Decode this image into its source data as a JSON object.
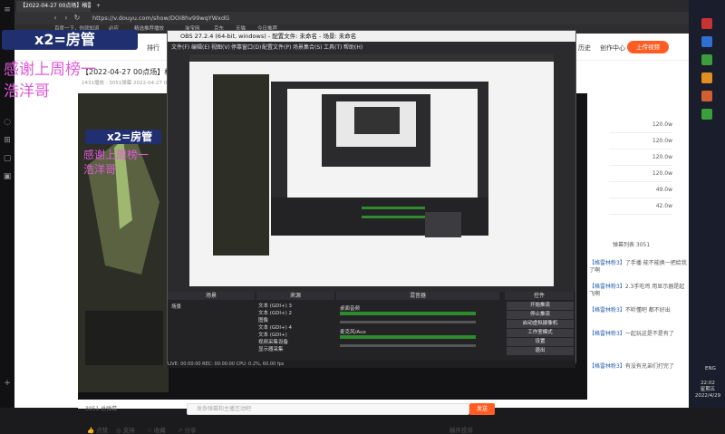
{
  "browser": {
    "tabs": [
      {
        "label": "【2022-04-27 00点场】格雷林"
      },
      {
        "label": ""
      },
      {
        "label": ""
      },
      {
        "label": ""
      }
    ],
    "url": "https://v.douyu.com/show/DOi8hv99wqYWxdG",
    "bookmarks": [
      "百度一下，你就知道",
      "必应",
      "精选推荐播放",
      "淘宝网",
      "京东",
      "天猫",
      "今日推荐"
    ]
  },
  "site": {
    "links": [
      "排行",
      "历史",
      "创作中心"
    ],
    "upload_label": "上传视频",
    "room_title": "【2022-04-27 00点场】格雷林",
    "room_meta": "1431播放 · 3051弹幕   2022-04-27 05:49",
    "rank_values": [
      "120.0w",
      "120.0w",
      "120.0w",
      "120.0w",
      "49.0w",
      "42.0w"
    ],
    "rank_head": "弹幕列表 3051",
    "chat": [
      {
        "name": "【格雷林粉3】",
        "text": "了手播 能不能换一把给我了啊"
      },
      {
        "name": "【格雷林粉3】",
        "text": "2.3手吃鸡 用显示器是起飞啊"
      },
      {
        "name": "【格雷林粉3】",
        "text": "不听懂吧 都不好出"
      },
      {
        "name": "【格雷林粉3】",
        "text": "一起玩这是不是有了"
      },
      {
        "name": "【格雷林粉3】",
        "text": "有没有兄弟们打完了"
      }
    ],
    "viewers": "3051 总弹幕",
    "danmu_placeholder": "发条弹幕和主播互动吧",
    "send_label": "发送",
    "actions": [
      "点赞",
      "支持",
      "收藏",
      "分享"
    ],
    "report_label": "稿件投诉"
  },
  "obs": {
    "title": "OBS 27.2.4 (64-bit, windows) - 配置文件: 未命名 - 场景: 未命名",
    "menu": [
      "文件(F)",
      "编辑(E)",
      "视图(V)",
      "停靠窗口(D)",
      "配置文件(P)",
      "场景集合(S)",
      "工具(T)",
      "帮助(H)"
    ],
    "docks": [
      "场景",
      "来源",
      "混音器",
      "转场特效",
      "控件"
    ],
    "no_source": "未选择源",
    "scene": "场景",
    "sources": [
      "文本 (GDI+) 3",
      "文本 (GDI+) 2",
      "图像",
      "文本 (GDI+) 4",
      "文本 (GDI+)",
      "视频采集设备",
      "显示器采集",
      "窗口采集"
    ],
    "mixer": [
      "桌面音频",
      "麦克风/Aux"
    ],
    "controls": [
      "开始推流",
      "停止推流",
      "启动虚拟摄像机",
      "工作室模式",
      "设置",
      "退出"
    ],
    "status": "LIVE: 00:00:00  REC: 00:00:00  CPU: 0.2%, 60.00 fps"
  },
  "overlay": {
    "badge": "x2=房管",
    "thanks": "感谢上周榜一",
    "name": "浩洋哥"
  },
  "taskbar": {
    "time": "22:02",
    "weekday": "星期五",
    "date": "2022/4/29",
    "lang": "ENG"
  }
}
